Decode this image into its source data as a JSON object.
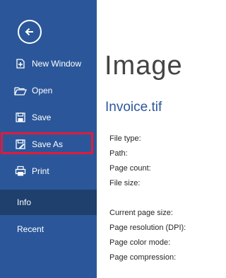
{
  "sidebar": {
    "back_label": "Back",
    "items": [
      {
        "label": "New Window",
        "icon": "new-window-icon"
      },
      {
        "label": "Open",
        "icon": "open-folder-icon"
      },
      {
        "label": "Save",
        "icon": "save-icon"
      },
      {
        "label": "Save As",
        "icon": "save-as-icon"
      },
      {
        "label": "Print",
        "icon": "print-icon"
      },
      {
        "label": "Info",
        "active": true
      },
      {
        "label": "Recent"
      }
    ],
    "highlighted_item": "Save As"
  },
  "main": {
    "title": "Image",
    "file_name": "Invoice.tif",
    "properties": [
      "File type:",
      "Path:",
      "Page count:",
      "File size:",
      "Current page size:",
      "Page resolution (DPI):",
      "Page color mode:",
      "Page compression:"
    ]
  },
  "colors": {
    "sidebar_bg": "#2b579a",
    "active_item_bg": "#1f3f6d",
    "highlight_border": "#e21a3b",
    "accent_text": "#2b579a"
  }
}
